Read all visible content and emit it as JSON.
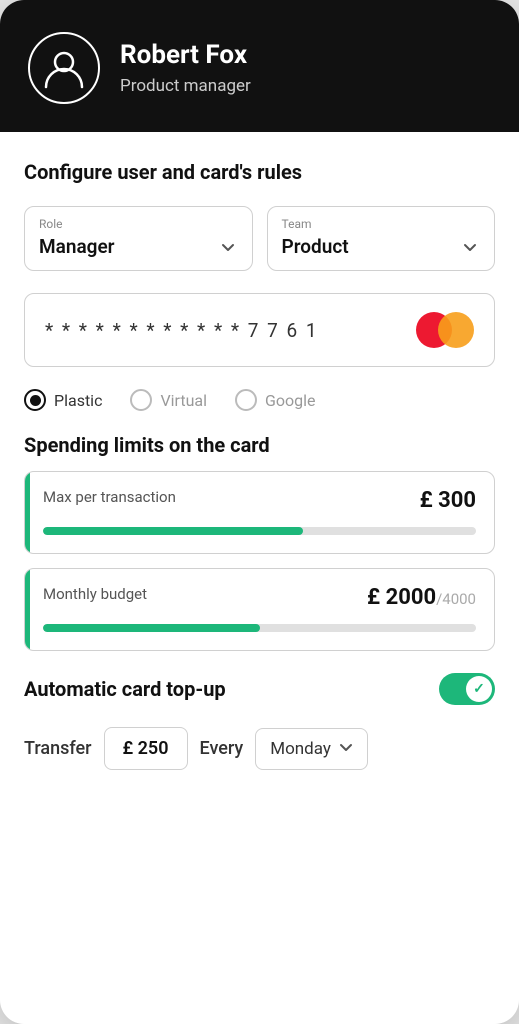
{
  "header": {
    "name": "Robert Fox",
    "role": "Product manager"
  },
  "section1": {
    "title": "Configure user and card's rules"
  },
  "role_dropdown": {
    "label": "Role",
    "value": "Manager"
  },
  "team_dropdown": {
    "label": "Team",
    "value": "Product"
  },
  "card": {
    "masked": "* * * *   * * * *   * * * *   7 7 6 1"
  },
  "card_types": {
    "options": [
      "Plastic",
      "Virtual",
      "Google"
    ],
    "selected": "Plastic"
  },
  "spending": {
    "title": "Spending limits on the card",
    "max_transaction": {
      "label": "Max per transaction",
      "currency": "£",
      "value": "300",
      "progress": 60
    },
    "monthly_budget": {
      "label": "Monthly budget",
      "currency": "£",
      "value": "2000",
      "total": "4000",
      "progress": 50
    }
  },
  "topup": {
    "title": "Automatic card top-up",
    "enabled": true,
    "transfer_label": "Transfer",
    "transfer_amount": "£ 250",
    "every_label": "Every",
    "day_value": "Monday"
  }
}
